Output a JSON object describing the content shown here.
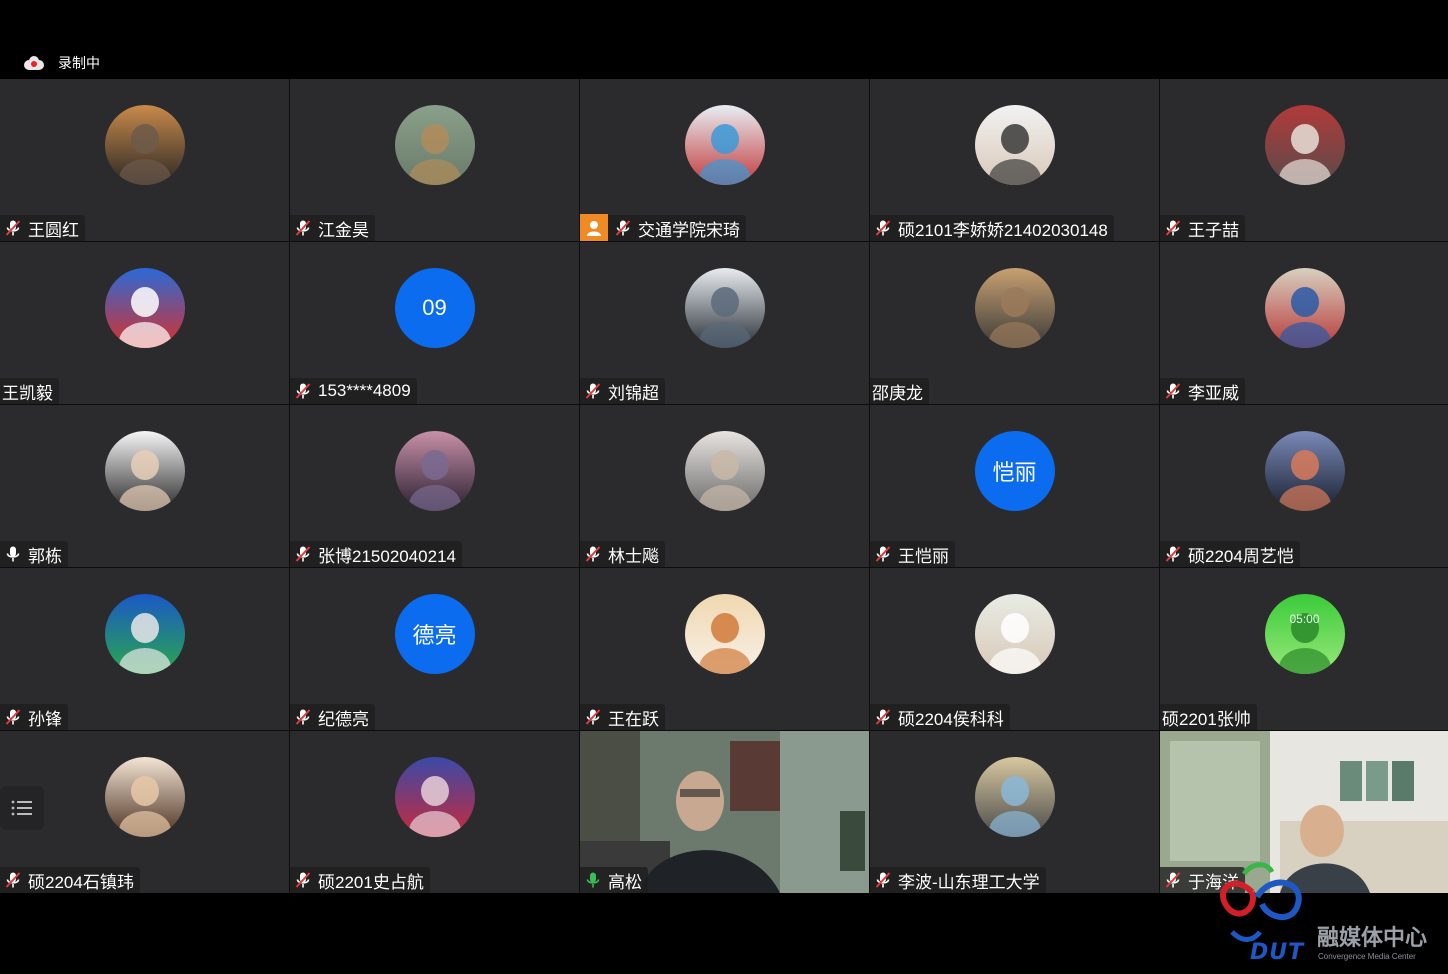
{
  "recording": {
    "label": "录制中"
  },
  "participants": [
    {
      "name": "王圆红",
      "mic": "muted",
      "avatar": "sunset-photo"
    },
    {
      "name": "江金昊",
      "mic": "muted",
      "avatar": "box-robot-photo"
    },
    {
      "name": "交通学院宋琦",
      "mic": "muted",
      "avatar": "snowman-photo",
      "host": true
    },
    {
      "name": "硕2101李娇娇21402030148",
      "mic": "muted",
      "avatar": "person-camera-photo"
    },
    {
      "name": "王子喆",
      "mic": "muted",
      "avatar": "toy-photo"
    },
    {
      "name": "王凯毅",
      "mic": "none",
      "avatar": "doraemon-photo"
    },
    {
      "name": "153****4809",
      "mic": "muted",
      "avatar_text": "09"
    },
    {
      "name": "刘锦超",
      "mic": "muted",
      "avatar": "mountain-photo"
    },
    {
      "name": "邵庚龙",
      "mic": "none",
      "avatar": "dog-photo"
    },
    {
      "name": "李亚威",
      "mic": "muted",
      "avatar": "poster-photo"
    },
    {
      "name": "郭栋",
      "mic": "on",
      "avatar": "portrait-photo"
    },
    {
      "name": "张博21502040214",
      "mic": "muted",
      "avatar": "dusk-photo"
    },
    {
      "name": "林士飚",
      "mic": "muted",
      "avatar": "baby-photo"
    },
    {
      "name": "王恺丽",
      "mic": "muted",
      "avatar_text": "恺丽"
    },
    {
      "name": "硕2204周艺恺",
      "mic": "muted",
      "avatar": "city-dusk-photo"
    },
    {
      "name": "孙锋",
      "mic": "muted",
      "avatar": "tennis-photo"
    },
    {
      "name": "纪德亮",
      "mic": "muted",
      "avatar_text": "德亮"
    },
    {
      "name": "王在跃",
      "mic": "muted",
      "avatar": "pomeranian-photo"
    },
    {
      "name": "硕2204侯科科",
      "mic": "muted",
      "avatar": "bear-photo"
    },
    {
      "name": "硕2201张帅",
      "mic": "none",
      "avatar": "green-leaf-photo",
      "avatar_overlay": "05:00"
    },
    {
      "name": "硕2204石镇玮",
      "mic": "muted",
      "avatar": "child-photo"
    },
    {
      "name": "硕2201史占航",
      "mic": "muted",
      "avatar": "anime-photo"
    },
    {
      "name": "高松",
      "mic": "speaking",
      "video": true
    },
    {
      "name": "李波-山东理工大学",
      "mic": "muted",
      "avatar": "beach-photo"
    },
    {
      "name": "于海洋",
      "mic": "muted",
      "video": true
    }
  ],
  "logo": {
    "brand": "DUT",
    "title_cn": "融媒体中心",
    "title_en": "Convergence Media Center"
  },
  "colors": {
    "tile_bg": "#2b2b2d",
    "avatar_blue": "#0b6cf0",
    "speaking": "#3bbd5a",
    "muted_red": "#e23b3b",
    "host_orange": "#f08a24"
  }
}
